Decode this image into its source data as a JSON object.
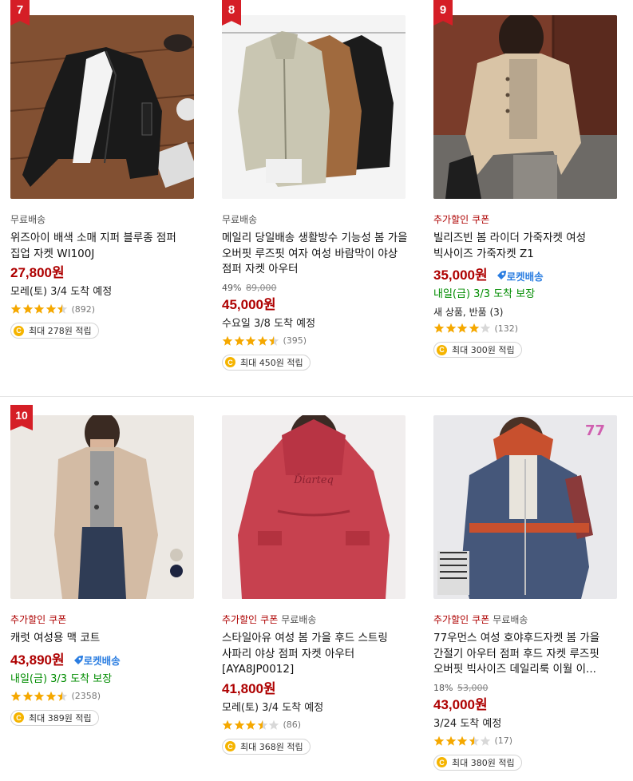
{
  "products": [
    {
      "rank": "7",
      "image_alt": "black zip-up bomber jacket",
      "badges": [],
      "gray_badge": "무료배송",
      "title": "위즈아이 배색 소매 지퍼 블루종 점퍼 집업 자켓 WI100J",
      "discount_rate": "",
      "original_price": "",
      "price": "27,800원",
      "rocket": "",
      "delivery": "모레(토) 3/4 도착 예정",
      "extra": "",
      "rating": 4.5,
      "review_count": "(892)",
      "cashback": "최대 278원 적립"
    },
    {
      "rank": "8",
      "image_alt": "hooded windbreaker jackets in beige brown black",
      "badges": [],
      "gray_badge": "무료배송",
      "title": "메일리 당일배송 생활방수 기능성 봄 가을 오버핏 루즈핏 여자 여성 바람막이 야상 점퍼 자켓 아우터",
      "discount_rate": "49%",
      "original_price": "89,000",
      "price": "45,000원",
      "rocket": "",
      "delivery": "수요일 3/8 도착 예정",
      "extra": "",
      "rating": 4.5,
      "review_count": "(395)",
      "cashback": "최대 450원 적립"
    },
    {
      "rank": "9",
      "image_alt": "beige leather rider jacket",
      "badges": [
        "추가할인",
        "쿠폰"
      ],
      "gray_badge": "",
      "title": "빌리즈빈 봄 라이더 가죽자켓 여성 빅사이즈 가죽자켓 Z1",
      "discount_rate": "",
      "original_price": "",
      "price": "35,000원",
      "rocket": "로켓배송",
      "delivery": "내일(금) 3/3 도착 보장",
      "extra": "새 상품, 반품 (3)",
      "rating": 4,
      "review_count": "(132)",
      "cashback": "최대 300원 적립"
    },
    {
      "rank": "10",
      "image_alt": "beige mac coat",
      "badges": [
        "추가할인",
        "쿠폰"
      ],
      "gray_badge": "",
      "title": "캐럿 여성용 맥 코트",
      "discount_rate": "",
      "original_price": "",
      "price": "43,890원",
      "rocket": "로켓배송",
      "delivery": "내일(금) 3/3 도착 보장",
      "extra": "",
      "rating": 4.5,
      "review_count": "(2358)",
      "cashback": "최대 389원 적립"
    },
    {
      "rank": "",
      "image_alt": "red hooded safari jacket back view",
      "badges": [
        "추가할인",
        "쿠폰"
      ],
      "gray_badge": "무료배송",
      "title": "스타일아유 여성 봄 가을 후드 스트링 사파리 야상 점퍼 자켓 아우터 [AYA8JP0012]",
      "discount_rate": "",
      "original_price": "",
      "price": "41,800원",
      "rocket": "",
      "delivery": "모레(토) 3/4 도착 예정",
      "extra": "",
      "rating": 3.5,
      "review_count": "(86)",
      "cashback": "최대 368원 적립"
    },
    {
      "rank": "",
      "image_alt": "denim hooded jacket with orange hood",
      "badges": [
        "추가할인",
        "쿠폰"
      ],
      "gray_badge": "무료배송",
      "title": "77우먼스 여성 호야후드자켓 봄 가을 간절기 아우터 점퍼 후드 자켓 루즈핏 오버핏 빅사이즈 데일리룩 이월 이...",
      "discount_rate": "18%",
      "original_price": "53,000",
      "price": "43,000원",
      "rocket": "",
      "delivery": "3/24 도착 예정",
      "extra": "",
      "rating": 3.5,
      "review_count": "(17)",
      "cashback": "최대 380원 적립"
    }
  ],
  "colors": {
    "price": "#ae0000",
    "rank_flag": "#d51e26",
    "star": "#f5a800",
    "rocket": "#2a7de1",
    "green": "#008c00"
  },
  "icons": {
    "rank": "ribbon-flag-icon",
    "rocket": "rocket-icon",
    "coin": "coin-c-icon",
    "star": "star-icon"
  }
}
